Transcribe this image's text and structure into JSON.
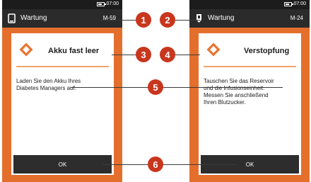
{
  "status_bar": {
    "time": "07:00"
  },
  "left_screen": {
    "header_title": "Wartung",
    "header_code": "M-59",
    "card_title": "Akku fast leer",
    "card_text": "Laden Sie den Akku Ihres\nDiabetes Managers auf.",
    "ok_label": "OK"
  },
  "right_screen": {
    "header_title": "Wartung",
    "header_code": "M-24",
    "card_title": "Verstopfung",
    "card_text": "Tauschen Sie das Reservoir\nund die Infusionseinheit.\nMessen Sie anschließend\nIhren Blutzucker.",
    "ok_label": "OK"
  },
  "callouts": [
    "1",
    "2",
    "3",
    "4",
    "5",
    "6"
  ],
  "colors": {
    "frame_orange": "#e46f2d",
    "warning_diamond": "#e8742e",
    "header_bg": "#2b2b2b",
    "callout_red": "#c8361d"
  },
  "icons": {
    "left_header": "device-icon",
    "right_header": "pump-cartridge-icon",
    "card": "warning-diamond-icon",
    "status": "battery-icon"
  }
}
